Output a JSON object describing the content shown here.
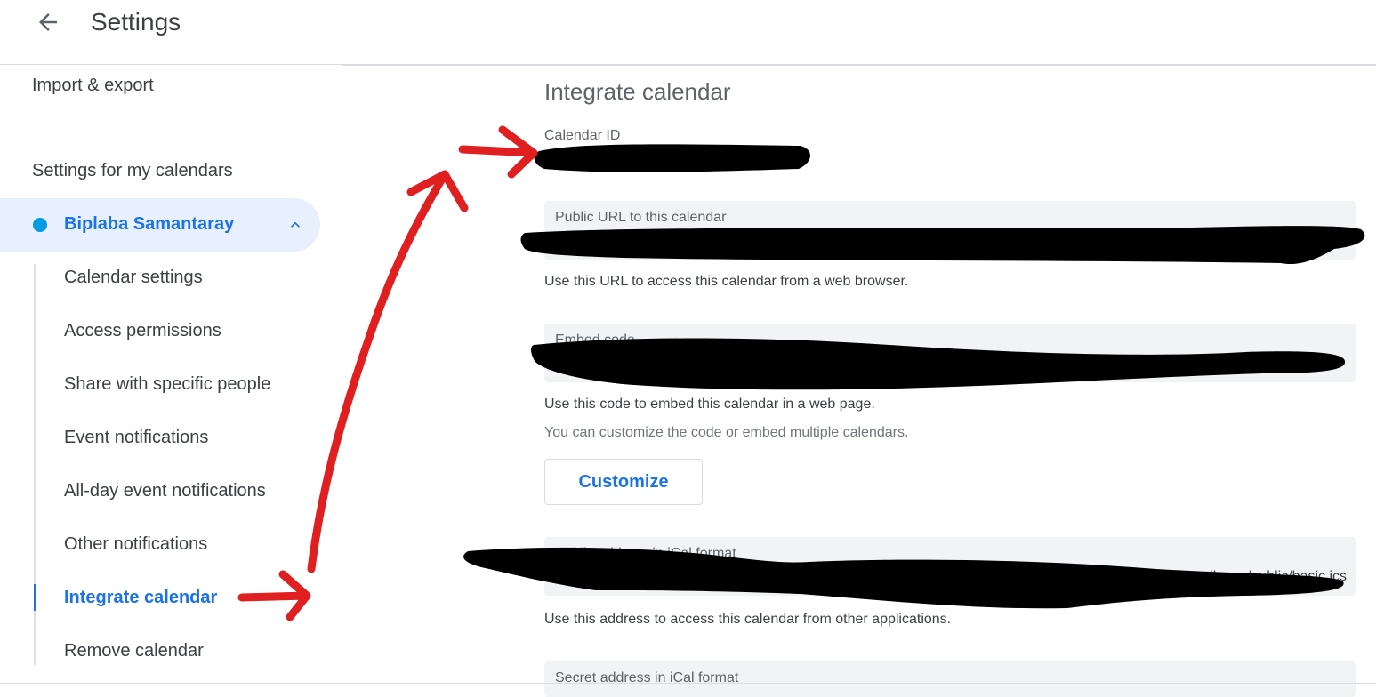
{
  "header": {
    "title": "Settings",
    "back_icon": "arrow-back-icon"
  },
  "sidebar": {
    "import_export": "Import & export",
    "my_calendars_heading": "Settings for my calendars",
    "calendar": {
      "name": "Biplaba Samantaray",
      "dot_color": "#039be5",
      "expanded": true
    },
    "items": [
      {
        "label": "Calendar settings",
        "active": false
      },
      {
        "label": "Access permissions",
        "active": false
      },
      {
        "label": "Share with specific people",
        "active": false
      },
      {
        "label": "Event notifications",
        "active": false
      },
      {
        "label": "All-day event notifications",
        "active": false
      },
      {
        "label": "Other notifications",
        "active": false
      },
      {
        "label": "Integrate calendar",
        "active": true
      },
      {
        "label": "Remove calendar",
        "active": false
      }
    ]
  },
  "main": {
    "title": "Integrate calendar",
    "calendar_id": {
      "label": "Calendar ID",
      "value": ""
    },
    "public_url": {
      "label": "Public URL to this calendar",
      "value": "",
      "description": "Use this URL to access this calendar from a web browser."
    },
    "embed": {
      "label": "Embed code",
      "value": "",
      "description": "Use this code to embed this calendar in a web page.",
      "hint": "You can customize the code or embed multiple calendars.",
      "button": "Customize"
    },
    "public_ical": {
      "label": "Public address in iCal format",
      "value": "gmail.com/public/basic.ics",
      "description": "Use this address to access this calendar from other applications."
    },
    "secret_ical": {
      "label": "Secret address in iCal format"
    }
  },
  "colors": {
    "accent": "#1a73e8",
    "active_bg": "#e8f0fe",
    "box_bg": "#f1f3f4",
    "annotation": "#e02020",
    "redaction": "#000000"
  }
}
